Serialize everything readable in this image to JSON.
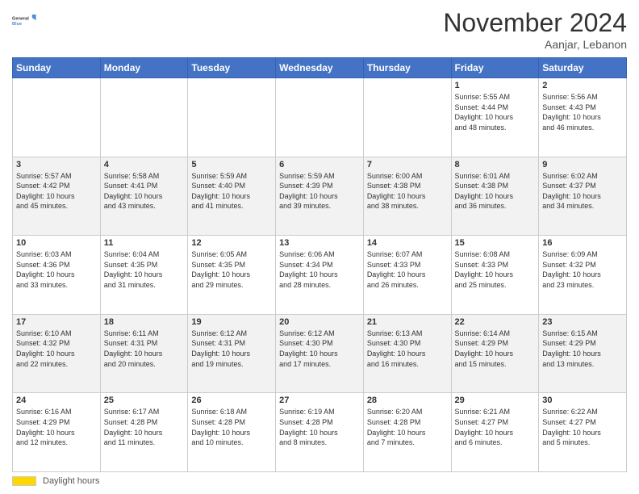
{
  "logo": {
    "line1": "General",
    "line2": "Blue"
  },
  "header": {
    "month": "November 2024",
    "location": "Aanjar, Lebanon"
  },
  "weekdays": [
    "Sunday",
    "Monday",
    "Tuesday",
    "Wednesday",
    "Thursday",
    "Friday",
    "Saturday"
  ],
  "weeks": [
    [
      {
        "day": "",
        "info": ""
      },
      {
        "day": "",
        "info": ""
      },
      {
        "day": "",
        "info": ""
      },
      {
        "day": "",
        "info": ""
      },
      {
        "day": "",
        "info": ""
      },
      {
        "day": "1",
        "info": "Sunrise: 5:55 AM\nSunset: 4:44 PM\nDaylight: 10 hours\nand 48 minutes."
      },
      {
        "day": "2",
        "info": "Sunrise: 5:56 AM\nSunset: 4:43 PM\nDaylight: 10 hours\nand 46 minutes."
      }
    ],
    [
      {
        "day": "3",
        "info": "Sunrise: 5:57 AM\nSunset: 4:42 PM\nDaylight: 10 hours\nand 45 minutes."
      },
      {
        "day": "4",
        "info": "Sunrise: 5:58 AM\nSunset: 4:41 PM\nDaylight: 10 hours\nand 43 minutes."
      },
      {
        "day": "5",
        "info": "Sunrise: 5:59 AM\nSunset: 4:40 PM\nDaylight: 10 hours\nand 41 minutes."
      },
      {
        "day": "6",
        "info": "Sunrise: 5:59 AM\nSunset: 4:39 PM\nDaylight: 10 hours\nand 39 minutes."
      },
      {
        "day": "7",
        "info": "Sunrise: 6:00 AM\nSunset: 4:38 PM\nDaylight: 10 hours\nand 38 minutes."
      },
      {
        "day": "8",
        "info": "Sunrise: 6:01 AM\nSunset: 4:38 PM\nDaylight: 10 hours\nand 36 minutes."
      },
      {
        "day": "9",
        "info": "Sunrise: 6:02 AM\nSunset: 4:37 PM\nDaylight: 10 hours\nand 34 minutes."
      }
    ],
    [
      {
        "day": "10",
        "info": "Sunrise: 6:03 AM\nSunset: 4:36 PM\nDaylight: 10 hours\nand 33 minutes."
      },
      {
        "day": "11",
        "info": "Sunrise: 6:04 AM\nSunset: 4:35 PM\nDaylight: 10 hours\nand 31 minutes."
      },
      {
        "day": "12",
        "info": "Sunrise: 6:05 AM\nSunset: 4:35 PM\nDaylight: 10 hours\nand 29 minutes."
      },
      {
        "day": "13",
        "info": "Sunrise: 6:06 AM\nSunset: 4:34 PM\nDaylight: 10 hours\nand 28 minutes."
      },
      {
        "day": "14",
        "info": "Sunrise: 6:07 AM\nSunset: 4:33 PM\nDaylight: 10 hours\nand 26 minutes."
      },
      {
        "day": "15",
        "info": "Sunrise: 6:08 AM\nSunset: 4:33 PM\nDaylight: 10 hours\nand 25 minutes."
      },
      {
        "day": "16",
        "info": "Sunrise: 6:09 AM\nSunset: 4:32 PM\nDaylight: 10 hours\nand 23 minutes."
      }
    ],
    [
      {
        "day": "17",
        "info": "Sunrise: 6:10 AM\nSunset: 4:32 PM\nDaylight: 10 hours\nand 22 minutes."
      },
      {
        "day": "18",
        "info": "Sunrise: 6:11 AM\nSunset: 4:31 PM\nDaylight: 10 hours\nand 20 minutes."
      },
      {
        "day": "19",
        "info": "Sunrise: 6:12 AM\nSunset: 4:31 PM\nDaylight: 10 hours\nand 19 minutes."
      },
      {
        "day": "20",
        "info": "Sunrise: 6:12 AM\nSunset: 4:30 PM\nDaylight: 10 hours\nand 17 minutes."
      },
      {
        "day": "21",
        "info": "Sunrise: 6:13 AM\nSunset: 4:30 PM\nDaylight: 10 hours\nand 16 minutes."
      },
      {
        "day": "22",
        "info": "Sunrise: 6:14 AM\nSunset: 4:29 PM\nDaylight: 10 hours\nand 15 minutes."
      },
      {
        "day": "23",
        "info": "Sunrise: 6:15 AM\nSunset: 4:29 PM\nDaylight: 10 hours\nand 13 minutes."
      }
    ],
    [
      {
        "day": "24",
        "info": "Sunrise: 6:16 AM\nSunset: 4:29 PM\nDaylight: 10 hours\nand 12 minutes."
      },
      {
        "day": "25",
        "info": "Sunrise: 6:17 AM\nSunset: 4:28 PM\nDaylight: 10 hours\nand 11 minutes."
      },
      {
        "day": "26",
        "info": "Sunrise: 6:18 AM\nSunset: 4:28 PM\nDaylight: 10 hours\nand 10 minutes."
      },
      {
        "day": "27",
        "info": "Sunrise: 6:19 AM\nSunset: 4:28 PM\nDaylight: 10 hours\nand 8 minutes."
      },
      {
        "day": "28",
        "info": "Sunrise: 6:20 AM\nSunset: 4:28 PM\nDaylight: 10 hours\nand 7 minutes."
      },
      {
        "day": "29",
        "info": "Sunrise: 6:21 AM\nSunset: 4:27 PM\nDaylight: 10 hours\nand 6 minutes."
      },
      {
        "day": "30",
        "info": "Sunrise: 6:22 AM\nSunset: 4:27 PM\nDaylight: 10 hours\nand 5 minutes."
      }
    ]
  ],
  "footer": {
    "daylight_label": "Daylight hours"
  }
}
